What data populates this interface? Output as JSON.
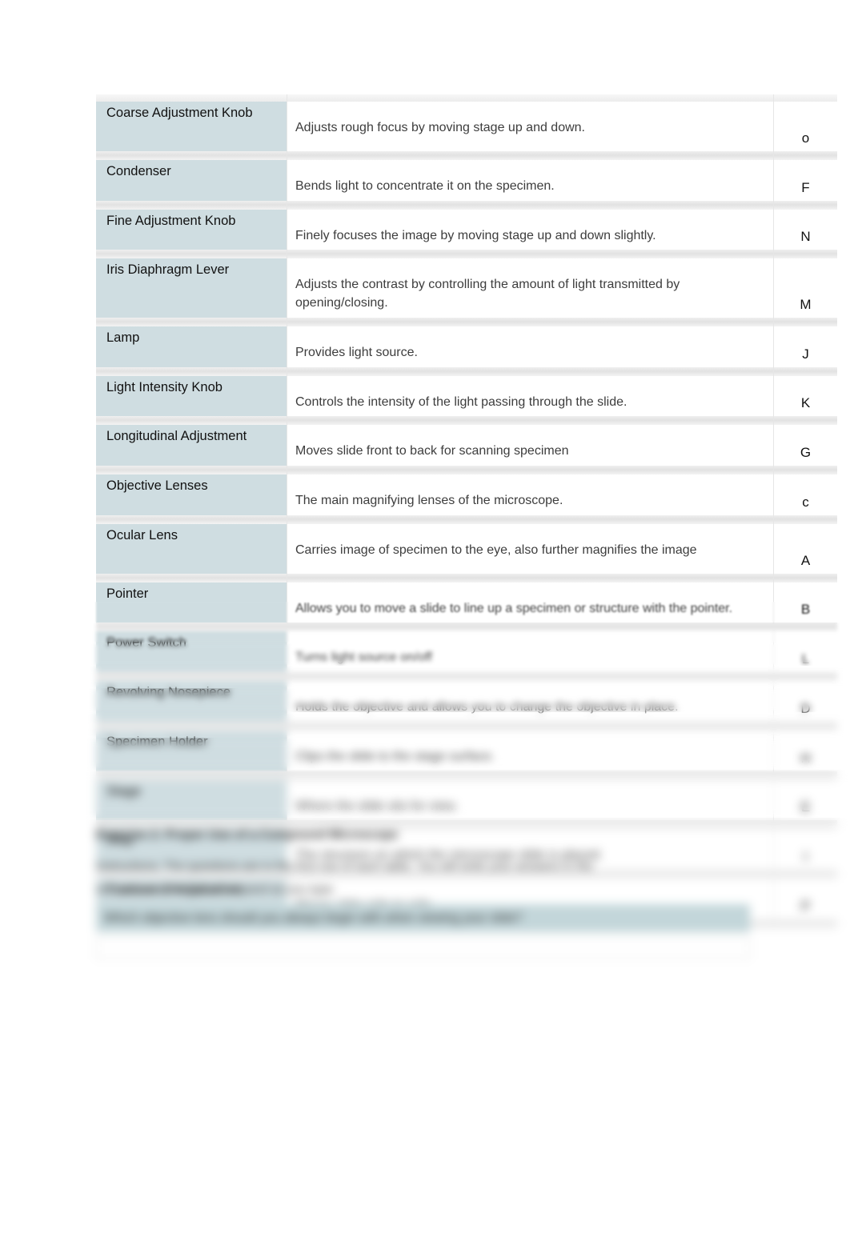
{
  "document": {
    "type": "worksheet",
    "background_color": "#ffffff",
    "name_column_color": "#cfdde1",
    "highlight_color": "#c3d6da"
  },
  "table": {
    "columns": [
      "Part Name",
      "Function",
      "Letter"
    ],
    "rows": [
      {
        "name": "Coarse Adjustment Knob",
        "desc": "Adjusts rough focus by moving stage up and down.",
        "letter": "o",
        "tall": true
      },
      {
        "name": "Condenser",
        "desc": "Bends light to concentrate it on the specimen.",
        "letter": "F",
        "tall": false
      },
      {
        "name": "Fine Adjustment Knob",
        "desc": "Finely focuses the image by moving stage up and down slightly.",
        "letter": "N",
        "tall": false
      },
      {
        "name": "Iris Diaphragm Lever",
        "desc": "Adjusts the contrast by controlling the amount of light transmitted by opening/closing.",
        "letter": "M",
        "tall": false
      },
      {
        "name": "Lamp",
        "desc": "Provides light source.",
        "letter": "J",
        "tall": false
      },
      {
        "name": "Light Intensity Knob",
        "desc": "Controls the intensity of the light passing through the slide.",
        "letter": "K",
        "tall": false
      },
      {
        "name": "Longitudinal Adjustment",
        "desc": "Moves slide front to back for scanning specimen",
        "letter": "G",
        "tall": false
      },
      {
        "name": "Objective Lenses",
        "desc": "The main magnifying lenses of the microscope.",
        "letter": "c",
        "tall": false
      },
      {
        "name": "Ocular Lens",
        "desc": "Carries image of specimen to the eye, also further magnifies the image",
        "letter": "A",
        "tall": true
      },
      {
        "name": "Pointer",
        "desc": "Allows you to move a slide to line up a specimen or structure with the pointer.",
        "letter": "B",
        "tall": false
      },
      {
        "name": "Power Switch",
        "desc": "Turns light source on/off",
        "letter": "L",
        "tall": false
      },
      {
        "name": "Revolving Nosepiece",
        "desc": "Holds the objective and allows you to change the objective in place.",
        "letter": "D",
        "tall": false
      },
      {
        "name": "Specimen Holder",
        "desc": "Clips the slide to the stage surface.",
        "letter": "H",
        "tall": false
      },
      {
        "name": "Stage",
        "desc": "Where the slide sits for view.",
        "letter": "E",
        "tall": false
      },
      {
        "name": "Stop",
        "desc": "The structure on which the microscope slide is placed.",
        "letter": "I",
        "tall": false
      },
      {
        "name": "Transverse Adjustment",
        "desc": "Moves slide side to side.",
        "letter": "P",
        "tall": false
      }
    ]
  },
  "bottom_section": {
    "heading": "Exercise 2: Proper Use of a Compound Microscope",
    "instruction_line_1": "Instructions: The questions are in the first row of each table. You will write your answers in the",
    "instruction_line_2": "second row. The cell will expand as you type.",
    "question": "Which objective lens should you always begin with when viewing your slide?",
    "answer_value": "",
    "answer_placeholder": ""
  }
}
